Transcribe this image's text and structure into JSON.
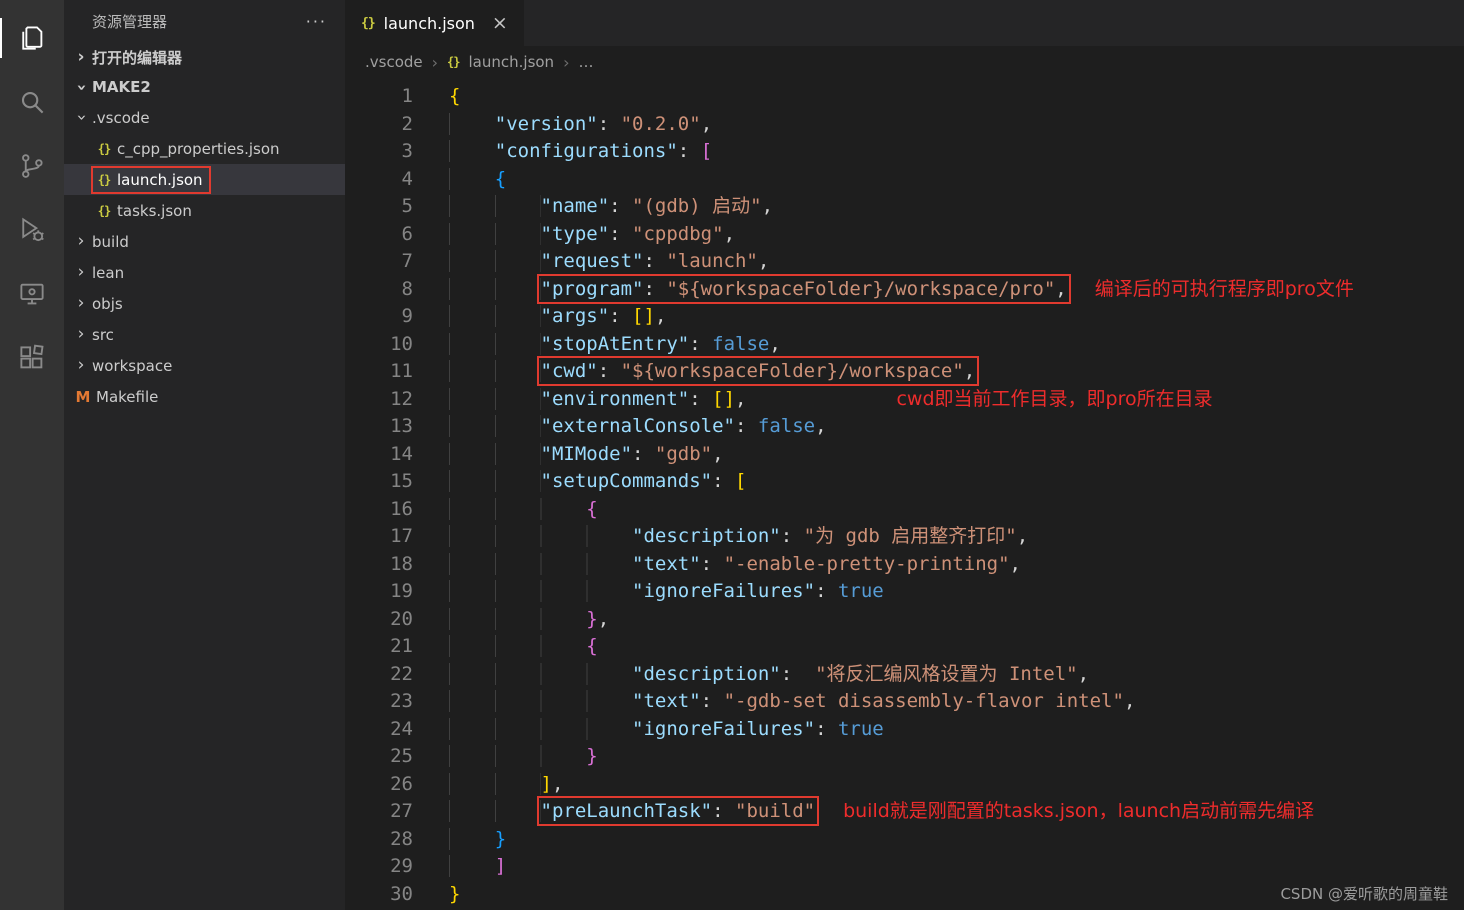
{
  "palette": {
    "activity_bar_bg": "#333333",
    "sidebar_bg": "#252526",
    "editor_bg": "#1e1e1e",
    "selected_item_bg": "#37373d",
    "annotation_red": "#ee2c2c",
    "key_color": "#9cdcfe",
    "string_color": "#ce9178",
    "keyword_color": "#569cd6",
    "bracket_gold": "#ffd700",
    "bracket_pink": "#da70d6",
    "bracket_blue": "#179fff",
    "line_number_color": "#858585",
    "json_icon_color": "#cbcb41",
    "makefile_icon_color": "#e37933"
  },
  "activity_bar": {
    "items": [
      {
        "name": "explorer",
        "active": true
      },
      {
        "name": "search",
        "active": false
      },
      {
        "name": "source-control",
        "active": false
      },
      {
        "name": "run-and-debug",
        "active": false
      },
      {
        "name": "remote-explorer",
        "active": false
      },
      {
        "name": "extensions",
        "active": false
      }
    ]
  },
  "sidebar": {
    "title": "资源管理器",
    "more_actions": "···",
    "open_editors_label": "打开的编辑器",
    "root_label": "MAKE2",
    "tree": [
      {
        "label": ".vscode",
        "kind": "folder",
        "depth": 1,
        "expanded": true
      },
      {
        "label": "c_cpp_properties.json",
        "kind": "json",
        "depth": 2
      },
      {
        "label": "launch.json",
        "kind": "json",
        "depth": 2,
        "selected": true,
        "boxed": true
      },
      {
        "label": "tasks.json",
        "kind": "json",
        "depth": 2
      },
      {
        "label": "build",
        "kind": "folder",
        "depth": 1
      },
      {
        "label": "lean",
        "kind": "folder",
        "depth": 1
      },
      {
        "label": "objs",
        "kind": "folder",
        "depth": 1
      },
      {
        "label": "src",
        "kind": "folder",
        "depth": 1
      },
      {
        "label": "workspace",
        "kind": "folder",
        "depth": 1
      },
      {
        "label": "Makefile",
        "kind": "makefile",
        "depth": 1
      }
    ]
  },
  "editor": {
    "tab": {
      "label": "launch.json",
      "close": "×",
      "icon": "{}"
    },
    "breadcrumb": {
      "items": [
        ".vscode",
        "launch.json",
        "…"
      ],
      "icon": "{}"
    },
    "watermark": "CSDN @爱听歌的周童鞋",
    "code": {
      "lines": [
        {
          "n": 1,
          "indent": 0,
          "tokens": [
            {
              "t": "g0",
              "v": "{"
            }
          ]
        },
        {
          "n": 2,
          "indent": 4,
          "tokens": [
            {
              "t": "k",
              "v": "\"version\""
            },
            {
              "t": "p",
              "v": ": "
            },
            {
              "t": "s",
              "v": "\"0.2.0\""
            },
            {
              "t": "p",
              "v": ","
            }
          ]
        },
        {
          "n": 3,
          "indent": 4,
          "tokens": [
            {
              "t": "k",
              "v": "\"configurations\""
            },
            {
              "t": "p",
              "v": ": "
            },
            {
              "t": "g1",
              "v": "["
            }
          ]
        },
        {
          "n": 4,
          "indent": 4,
          "tokens": [
            {
              "t": "g2",
              "v": "{"
            }
          ]
        },
        {
          "n": 5,
          "indent": 8,
          "tokens": [
            {
              "t": "k",
              "v": "\"name\""
            },
            {
              "t": "p",
              "v": ": "
            },
            {
              "t": "s",
              "v": "\"(gdb) 启动\""
            },
            {
              "t": "p",
              "v": ","
            }
          ]
        },
        {
          "n": 6,
          "indent": 8,
          "tokens": [
            {
              "t": "k",
              "v": "\"type\""
            },
            {
              "t": "p",
              "v": ": "
            },
            {
              "t": "s",
              "v": "\"cppdbg\""
            },
            {
              "t": "p",
              "v": ","
            }
          ]
        },
        {
          "n": 7,
          "indent": 8,
          "tokens": [
            {
              "t": "k",
              "v": "\"request\""
            },
            {
              "t": "p",
              "v": ": "
            },
            {
              "t": "s",
              "v": "\"launch\""
            },
            {
              "t": "p",
              "v": ","
            }
          ]
        },
        {
          "n": 8,
          "indent": 8,
          "boxed": true,
          "tokens": [
            {
              "t": "k",
              "v": "\"program\""
            },
            {
              "t": "p",
              "v": ": "
            },
            {
              "t": "s",
              "v": "\"${workspaceFolder}/workspace/pro\""
            },
            {
              "t": "p",
              "v": ","
            }
          ],
          "note": "编译后的可执行程序即pro文件"
        },
        {
          "n": 9,
          "indent": 8,
          "tokens": [
            {
              "t": "k",
              "v": "\"args\""
            },
            {
              "t": "p",
              "v": ": "
            },
            {
              "t": "g0",
              "v": "[]"
            },
            {
              "t": "p",
              "v": ","
            }
          ]
        },
        {
          "n": 10,
          "indent": 8,
          "tokens": [
            {
              "t": "k",
              "v": "\"stopAtEntry\""
            },
            {
              "t": "p",
              "v": ": "
            },
            {
              "t": "b",
              "v": "false"
            },
            {
              "t": "p",
              "v": ","
            }
          ]
        },
        {
          "n": 11,
          "indent": 8,
          "boxed": true,
          "tokens": [
            {
              "t": "k",
              "v": "\"cwd\""
            },
            {
              "t": "p",
              "v": ": "
            },
            {
              "t": "s",
              "v": "\"${workspaceFolder}/workspace\""
            },
            {
              "t": "p",
              "v": ","
            }
          ]
        },
        {
          "n": 12,
          "indent": 8,
          "tokens": [
            {
              "t": "k",
              "v": "\"environment\""
            },
            {
              "t": "p",
              "v": ": "
            },
            {
              "t": "g0",
              "v": "[]"
            },
            {
              "t": "p",
              "v": ","
            }
          ],
          "note": "cwd即当前工作目录，即pro所在目录"
        },
        {
          "n": 13,
          "indent": 8,
          "tokens": [
            {
              "t": "k",
              "v": "\"externalConsole\""
            },
            {
              "t": "p",
              "v": ": "
            },
            {
              "t": "b",
              "v": "false"
            },
            {
              "t": "p",
              "v": ","
            }
          ]
        },
        {
          "n": 14,
          "indent": 8,
          "tokens": [
            {
              "t": "k",
              "v": "\"MIMode\""
            },
            {
              "t": "p",
              "v": ": "
            },
            {
              "t": "s",
              "v": "\"gdb\""
            },
            {
              "t": "p",
              "v": ","
            }
          ]
        },
        {
          "n": 15,
          "indent": 8,
          "tokens": [
            {
              "t": "k",
              "v": "\"setupCommands\""
            },
            {
              "t": "p",
              "v": ": "
            },
            {
              "t": "g0",
              "v": "["
            }
          ]
        },
        {
          "n": 16,
          "indent": 12,
          "tokens": [
            {
              "t": "g1",
              "v": "{"
            }
          ]
        },
        {
          "n": 17,
          "indent": 16,
          "tokens": [
            {
              "t": "k",
              "v": "\"description\""
            },
            {
              "t": "p",
              "v": ": "
            },
            {
              "t": "s",
              "v": "\"为 gdb 启用整齐打印\""
            },
            {
              "t": "p",
              "v": ","
            }
          ]
        },
        {
          "n": 18,
          "indent": 16,
          "tokens": [
            {
              "t": "k",
              "v": "\"text\""
            },
            {
              "t": "p",
              "v": ": "
            },
            {
              "t": "s",
              "v": "\"-enable-pretty-printing\""
            },
            {
              "t": "p",
              "v": ","
            }
          ]
        },
        {
          "n": 19,
          "indent": 16,
          "tokens": [
            {
              "t": "k",
              "v": "\"ignoreFailures\""
            },
            {
              "t": "p",
              "v": ": "
            },
            {
              "t": "b",
              "v": "true"
            }
          ]
        },
        {
          "n": 20,
          "indent": 12,
          "tokens": [
            {
              "t": "g1",
              "v": "}"
            },
            {
              "t": "p",
              "v": ","
            }
          ]
        },
        {
          "n": 21,
          "indent": 12,
          "tokens": [
            {
              "t": "g1",
              "v": "{"
            }
          ]
        },
        {
          "n": 22,
          "indent": 16,
          "tokens": [
            {
              "t": "k",
              "v": "\"description\""
            },
            {
              "t": "p",
              "v": ":  "
            },
            {
              "t": "s",
              "v": "\"将反汇编风格设置为 Intel\""
            },
            {
              "t": "p",
              "v": ","
            }
          ]
        },
        {
          "n": 23,
          "indent": 16,
          "tokens": [
            {
              "t": "k",
              "v": "\"text\""
            },
            {
              "t": "p",
              "v": ": "
            },
            {
              "t": "s",
              "v": "\"-gdb-set disassembly-flavor intel\""
            },
            {
              "t": "p",
              "v": ","
            }
          ]
        },
        {
          "n": 24,
          "indent": 16,
          "tokens": [
            {
              "t": "k",
              "v": "\"ignoreFailures\""
            },
            {
              "t": "p",
              "v": ": "
            },
            {
              "t": "b",
              "v": "true"
            }
          ]
        },
        {
          "n": 25,
          "indent": 12,
          "tokens": [
            {
              "t": "g1",
              "v": "}"
            }
          ]
        },
        {
          "n": 26,
          "indent": 8,
          "tokens": [
            {
              "t": "g0",
              "v": "]"
            },
            {
              "t": "p",
              "v": ","
            }
          ]
        },
        {
          "n": 27,
          "indent": 8,
          "boxed": true,
          "tokens": [
            {
              "t": "k",
              "v": "\"preLaunchTask\""
            },
            {
              "t": "p",
              "v": ": "
            },
            {
              "t": "s",
              "v": "\"build\""
            }
          ],
          "note": "build就是刚配置的tasks.json，launch启动前需先编译"
        },
        {
          "n": 28,
          "indent": 4,
          "tokens": [
            {
              "t": "g2",
              "v": "}"
            }
          ]
        },
        {
          "n": 29,
          "indent": 4,
          "tokens": [
            {
              "t": "g1",
              "v": "]"
            }
          ]
        },
        {
          "n": 30,
          "indent": 0,
          "tokens": [
            {
              "t": "g0",
              "v": "}"
            }
          ]
        }
      ]
    }
  }
}
